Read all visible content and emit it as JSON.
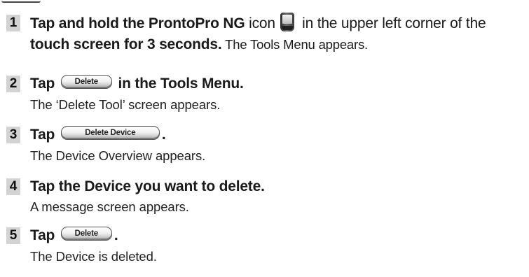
{
  "steps": [
    {
      "number": "1",
      "line1": {
        "before": "Tap and hold the ",
        "brand": "ProntoPro NG",
        "middle": " icon ",
        "icon": "prontopro-device-icon",
        "after": " in the upper left corner of the"
      },
      "line2": {
        "bold": "touch screen for 3 seconds.",
        "normal": " The Tools Menu appears."
      }
    },
    {
      "number": "2",
      "line1": {
        "before": "Tap ",
        "button": "Delete",
        "after": " in the Tools Menu."
      },
      "line2": {
        "text": "The ‘Delete Tool’ screen appears."
      }
    },
    {
      "number": "3",
      "line1": {
        "before": "Tap ",
        "button": "Delete Device",
        "after": "."
      },
      "line2": {
        "text": "The Device Overview appears."
      }
    },
    {
      "number": "4",
      "line1": {
        "text": "Tap the Device you want to delete."
      },
      "line2": {
        "text": "A message screen appears."
      }
    },
    {
      "number": "5",
      "line1": {
        "before": "Tap ",
        "button": "Delete",
        "after": "."
      },
      "line2": {
        "text": "The Device is deleted."
      }
    }
  ]
}
